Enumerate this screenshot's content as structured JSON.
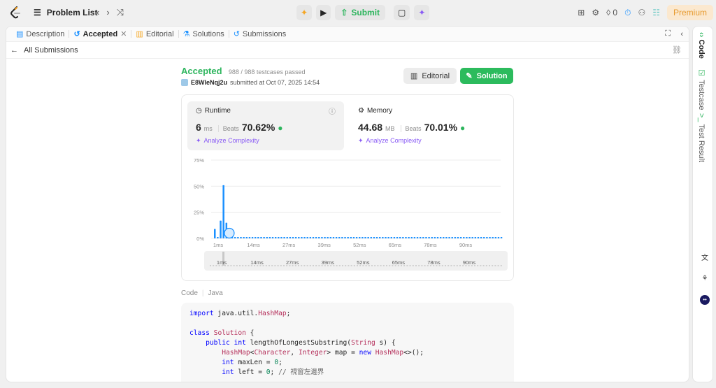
{
  "header": {
    "problem_list": "Problem List",
    "submit": "Submit",
    "streak": "0",
    "premium": "Premium"
  },
  "tabs": [
    {
      "label": "Description"
    },
    {
      "label": "Accepted"
    },
    {
      "label": "Editorial"
    },
    {
      "label": "Solutions"
    },
    {
      "label": "Submissions"
    }
  ],
  "subbar": {
    "back_label": "All Submissions"
  },
  "result": {
    "status": "Accepted",
    "testcases": "988 / 988 testcases passed",
    "user": "E8WleNqj2u",
    "submitted_at": "submitted at Oct 07, 2025 14:54",
    "editorial_btn": "Editorial",
    "solution_btn": "Solution"
  },
  "runtime": {
    "label": "Runtime",
    "value": "6",
    "unit": "ms",
    "beats_label": "Beats",
    "beats": "70.62%",
    "analyze": "Analyze Complexity"
  },
  "memory": {
    "label": "Memory",
    "value": "44.68",
    "unit": "MB",
    "beats_label": "Beats",
    "beats": "70.01%",
    "analyze": "Analyze Complexity"
  },
  "chart_data": {
    "type": "bar",
    "y_ticks": [
      "75%",
      "50%",
      "25%",
      "0%"
    ],
    "ylim": [
      0,
      75
    ],
    "x_ticks": [
      "1ms",
      "14ms",
      "27ms",
      "39ms",
      "52ms",
      "65ms",
      "78ms",
      "90ms"
    ],
    "x": [
      1,
      2,
      3,
      4,
      5,
      6,
      7,
      8,
      9,
      10,
      11,
      12,
      13,
      14,
      15,
      16,
      17,
      18,
      19,
      20,
      21,
      22,
      23,
      24,
      25,
      26,
      27,
      28,
      29,
      30,
      31,
      32,
      33,
      34,
      35,
      36,
      37,
      38,
      39,
      40,
      41,
      42,
      43,
      44,
      45,
      46,
      47,
      48,
      49,
      50,
      51,
      52,
      53,
      54,
      55,
      56,
      57,
      58,
      59,
      60,
      61,
      62,
      63,
      64,
      65,
      66,
      67,
      68,
      69,
      70,
      71,
      72,
      73,
      74,
      75,
      76,
      77,
      78,
      79,
      80,
      81,
      82,
      83,
      84,
      85,
      86,
      87,
      88,
      89,
      90,
      91,
      92,
      93,
      94,
      95,
      96,
      97,
      98,
      99,
      100
    ],
    "values": [
      9,
      1,
      17,
      51,
      15,
      1,
      1,
      1,
      1,
      1,
      1,
      1,
      1,
      1,
      1,
      1,
      1,
      1,
      1,
      1,
      1,
      1,
      1,
      1,
      1,
      1,
      1,
      1,
      1,
      1,
      1,
      1,
      1,
      1,
      1,
      1,
      1,
      1,
      1,
      1,
      1,
      1,
      1,
      1,
      1,
      1,
      1,
      1,
      1,
      1,
      1,
      1,
      1,
      1,
      1,
      1,
      1,
      1,
      1,
      1,
      1,
      1,
      1,
      1,
      1,
      1,
      1,
      1,
      1,
      1,
      1,
      1,
      1,
      1,
      1,
      1,
      1,
      1,
      1,
      1,
      1,
      1,
      1,
      1,
      1,
      1,
      1,
      1,
      1,
      1,
      1,
      1,
      1,
      1,
      1,
      1,
      1,
      1,
      1,
      1
    ],
    "highlight_x": 6,
    "bar_color": "#1a90ff"
  },
  "code": {
    "label": "Code",
    "lang": "Java"
  },
  "rail": {
    "code": "Code",
    "testcase": "Testcase",
    "result": "Test Result"
  }
}
